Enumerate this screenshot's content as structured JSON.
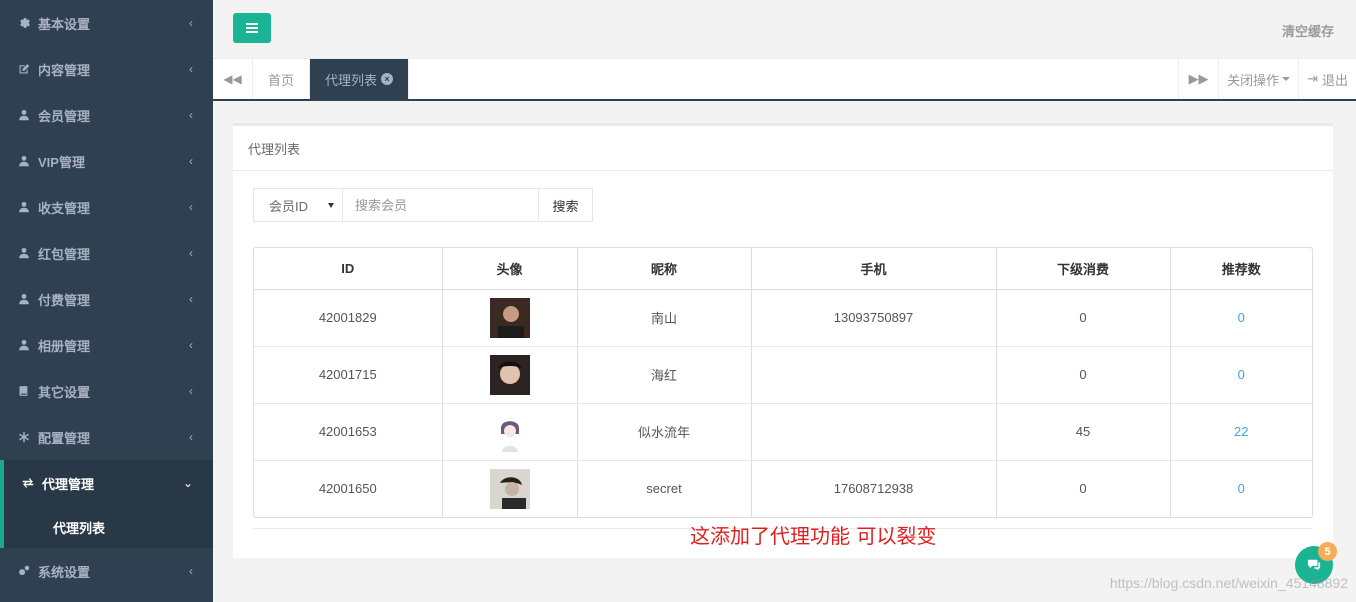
{
  "sidebar": {
    "items": [
      {
        "label": "基本设置",
        "icon": "gear-icon"
      },
      {
        "label": "内容管理",
        "icon": "edit-icon"
      },
      {
        "label": "会员管理",
        "icon": "user-icon"
      },
      {
        "label": "VIP管理",
        "icon": "user-icon"
      },
      {
        "label": "收支管理",
        "icon": "user-icon"
      },
      {
        "label": "红包管理",
        "icon": "user-icon"
      },
      {
        "label": "付费管理",
        "icon": "user-icon"
      },
      {
        "label": "相册管理",
        "icon": "user-icon"
      },
      {
        "label": "其它设置",
        "icon": "book-icon"
      },
      {
        "label": "配置管理",
        "icon": "asterisk-icon"
      },
      {
        "label": "代理管理",
        "icon": "exchange-icon"
      },
      {
        "label": "系统设置",
        "icon": "gears-icon"
      }
    ],
    "sub_item": "代理列表"
  },
  "topbar": {
    "clear_cache": "清空缓存"
  },
  "tabs": {
    "home": "首页",
    "active": "代理列表",
    "close_ops": "关闭操作",
    "logout": "退出"
  },
  "panel": {
    "title": "代理列表"
  },
  "search": {
    "select_value": "会员ID",
    "placeholder": "搜索会员",
    "button": "搜索"
  },
  "table": {
    "headers": [
      "ID",
      "头像",
      "昵称",
      "手机",
      "下级消费",
      "推荐数"
    ],
    "rows": [
      {
        "id": "42001829",
        "nickname": "南山",
        "phone": "13093750897",
        "consumption": "0",
        "referrals": "0"
      },
      {
        "id": "42001715",
        "nickname": "海红",
        "phone": "",
        "consumption": "0",
        "referrals": "0"
      },
      {
        "id": "42001653",
        "nickname": "似水流年",
        "phone": "",
        "consumption": "45",
        "referrals": "22"
      },
      {
        "id": "42001650",
        "nickname": "secret",
        "phone": "17608712938",
        "consumption": "0",
        "referrals": "0"
      }
    ]
  },
  "annotation": "这添加了代理功能 可以裂变",
  "chat": {
    "badge": "5"
  },
  "watermark": "https://blog.csdn.net/weixin_45148892",
  "colors": {
    "sidebar": "#2f4050",
    "accent": "#1ab394",
    "link": "#3ba7d8",
    "annotation": "#e02020"
  }
}
